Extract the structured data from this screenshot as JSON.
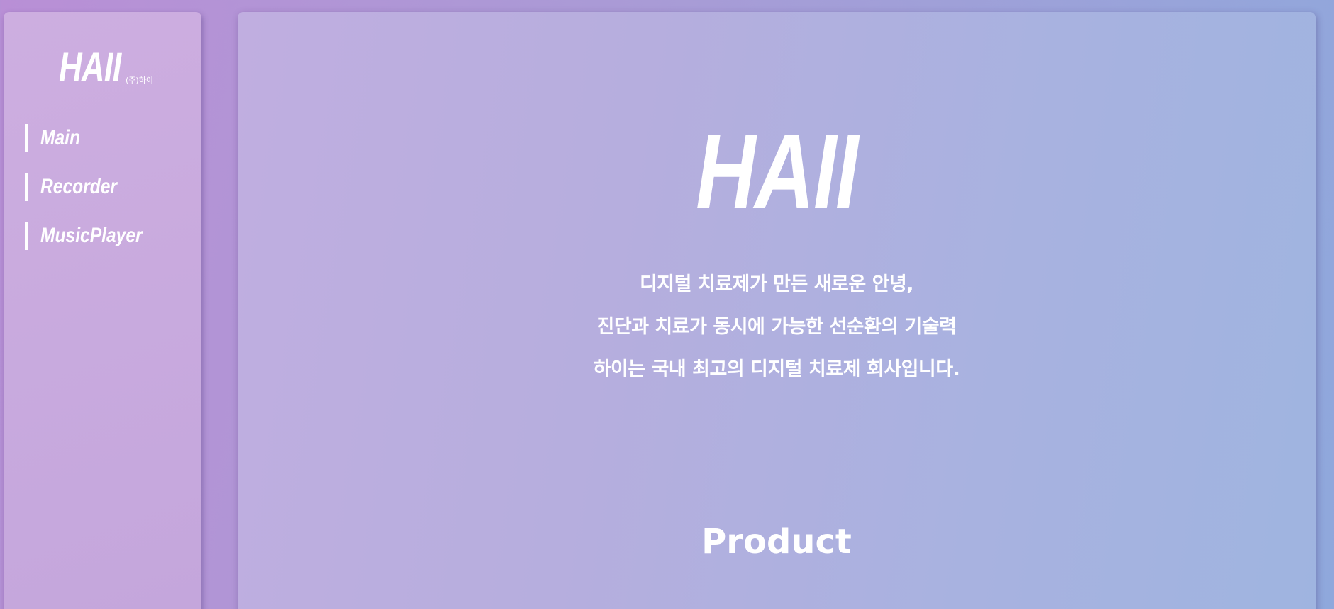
{
  "sidebar": {
    "brand": {
      "name": "HAII",
      "subtitle": "(주)하이"
    },
    "nav": [
      {
        "label": "Main"
      },
      {
        "label": "Recorder"
      },
      {
        "label": "MusicPlayer"
      }
    ]
  },
  "main": {
    "hero_logo": "HAII",
    "tagline": [
      "디지털 치료제가 만든 새로운 안녕,",
      "진단과 치료가 동시에 가능한 선순환의 기술력",
      "하이는 국내 최고의 디지털 치료제 회사입니다."
    ],
    "section_title": "Product"
  },
  "colors": {
    "background_start": "#b98fd6",
    "background_end": "#8fa8dc",
    "text": "#ffffff"
  }
}
